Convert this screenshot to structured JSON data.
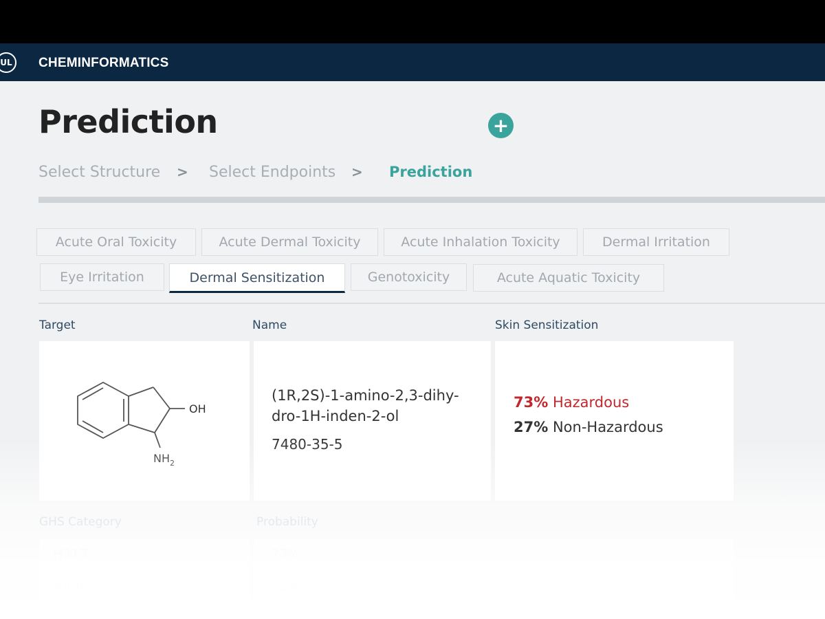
{
  "app": {
    "logo_text": "UL",
    "name": "CHEMINFORMATICS"
  },
  "page": {
    "title": "Prediction",
    "add_label": "+"
  },
  "breadcrumb": {
    "steps": [
      "Select Structure",
      "Select Endpoints",
      "Prediction"
    ],
    "separator": ">"
  },
  "tabs": [
    "Acute Oral Toxicity",
    "Acute Dermal Toxicity",
    "Acute Inhalation Toxicity",
    "Dermal Irritation",
    "Eye Irritation",
    "Dermal Sensitization",
    "Genotoxicity",
    "Acute Aquatic Toxicity"
  ],
  "selected_tab": "Dermal Sensitization",
  "columns": {
    "target": "Target",
    "name": "Name",
    "prediction": "Skin Sensitization"
  },
  "molecule": {
    "oh_label": "OH",
    "nh2_label": "NH",
    "nh2_sub": "2"
  },
  "compound": {
    "name": "(1R,2S)-1-amino-2,3-dihy-dro-1H-inden-2-ol",
    "cas": "7480-35-5"
  },
  "prediction": {
    "hazardous_pct": "73%",
    "hazardous_label": "Hazardous",
    "non_hazardous_pct": "27%",
    "non_hazardous_label": "Non-Hazardous"
  },
  "ghs": {
    "category_header": "GHS Category",
    "probability_header": "Probability",
    "rows": [
      {
        "category": "H317",
        "probability": "73%"
      },
      {
        "category": "Total",
        "probability": "73%"
      }
    ]
  },
  "colors": {
    "accent": "#3aa39c",
    "navy": "#0b2741",
    "hazard": "#c0282d"
  }
}
